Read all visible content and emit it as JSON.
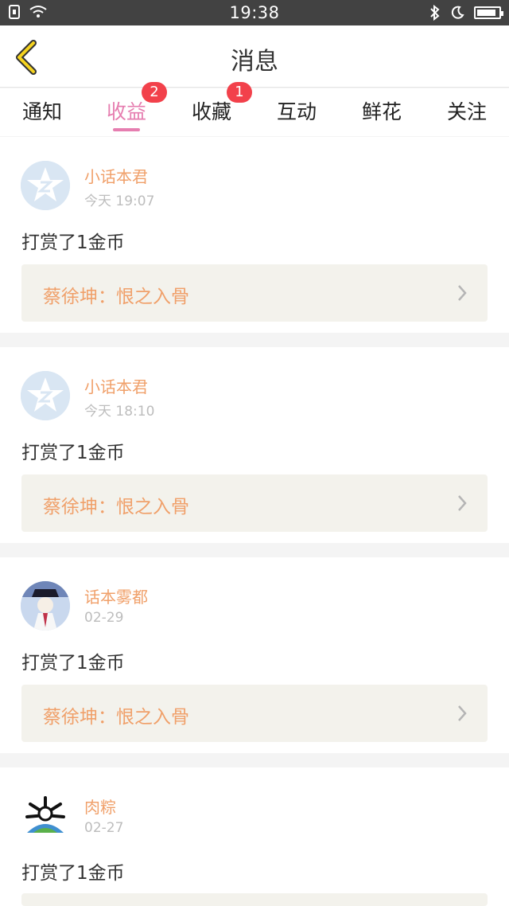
{
  "status_bar": {
    "time": "19:38"
  },
  "header": {
    "title": "消息"
  },
  "tabs": [
    {
      "label": "通知"
    },
    {
      "label": "收益",
      "badge": "2"
    },
    {
      "label": "收藏",
      "badge": "1"
    },
    {
      "label": "互动"
    },
    {
      "label": "鲜花"
    },
    {
      "label": "关注"
    }
  ],
  "messages": [
    {
      "name": "小话本君",
      "time": "今天 19:07",
      "text": "打赏了1金币",
      "ref": "蔡徐坤：恨之入骨"
    },
    {
      "name": "小话本君",
      "time": "今天 18:10",
      "text": "打赏了1金币",
      "ref": "蔡徐坤：恨之入骨"
    },
    {
      "name": "话本雾都",
      "time": "02-29",
      "text": "打赏了1金币",
      "ref": "蔡徐坤：恨之入骨"
    },
    {
      "name": "肉粽",
      "time": "02-27",
      "text": "打赏了1金币",
      "ref": ""
    }
  ],
  "colors": {
    "accent_pink": "#e67eb0",
    "name_orange": "#f0a06a",
    "badge_red": "#f2414b",
    "back_yellow": "#f5d31f",
    "battery_level": 0.9
  }
}
